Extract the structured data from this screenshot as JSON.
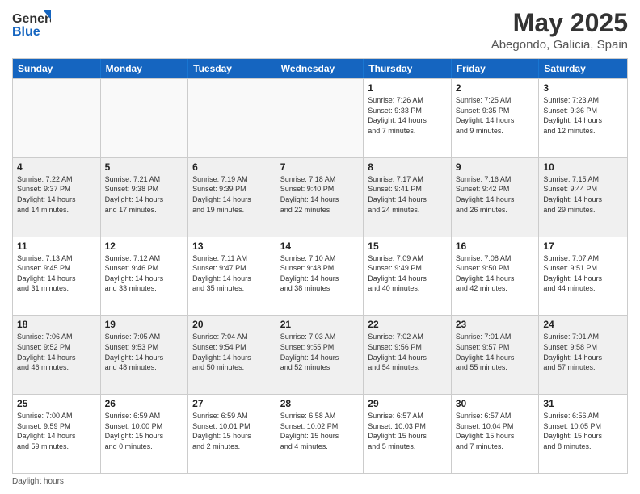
{
  "header": {
    "logo_line1": "General",
    "logo_line2": "Blue",
    "main_title": "May 2025",
    "subtitle": "Abegondo, Galicia, Spain"
  },
  "calendar": {
    "weekdays": [
      "Sunday",
      "Monday",
      "Tuesday",
      "Wednesday",
      "Thursday",
      "Friday",
      "Saturday"
    ],
    "rows": [
      [
        {
          "day": "",
          "info": "",
          "empty": true
        },
        {
          "day": "",
          "info": "",
          "empty": true
        },
        {
          "day": "",
          "info": "",
          "empty": true
        },
        {
          "day": "",
          "info": "",
          "empty": true
        },
        {
          "day": "1",
          "info": "Sunrise: 7:26 AM\nSunset: 9:33 PM\nDaylight: 14 hours\nand 7 minutes.",
          "empty": false
        },
        {
          "day": "2",
          "info": "Sunrise: 7:25 AM\nSunset: 9:35 PM\nDaylight: 14 hours\nand 9 minutes.",
          "empty": false
        },
        {
          "day": "3",
          "info": "Sunrise: 7:23 AM\nSunset: 9:36 PM\nDaylight: 14 hours\nand 12 minutes.",
          "empty": false
        }
      ],
      [
        {
          "day": "4",
          "info": "Sunrise: 7:22 AM\nSunset: 9:37 PM\nDaylight: 14 hours\nand 14 minutes.",
          "empty": false
        },
        {
          "day": "5",
          "info": "Sunrise: 7:21 AM\nSunset: 9:38 PM\nDaylight: 14 hours\nand 17 minutes.",
          "empty": false
        },
        {
          "day": "6",
          "info": "Sunrise: 7:19 AM\nSunset: 9:39 PM\nDaylight: 14 hours\nand 19 minutes.",
          "empty": false
        },
        {
          "day": "7",
          "info": "Sunrise: 7:18 AM\nSunset: 9:40 PM\nDaylight: 14 hours\nand 22 minutes.",
          "empty": false
        },
        {
          "day": "8",
          "info": "Sunrise: 7:17 AM\nSunset: 9:41 PM\nDaylight: 14 hours\nand 24 minutes.",
          "empty": false
        },
        {
          "day": "9",
          "info": "Sunrise: 7:16 AM\nSunset: 9:42 PM\nDaylight: 14 hours\nand 26 minutes.",
          "empty": false
        },
        {
          "day": "10",
          "info": "Sunrise: 7:15 AM\nSunset: 9:44 PM\nDaylight: 14 hours\nand 29 minutes.",
          "empty": false
        }
      ],
      [
        {
          "day": "11",
          "info": "Sunrise: 7:13 AM\nSunset: 9:45 PM\nDaylight: 14 hours\nand 31 minutes.",
          "empty": false
        },
        {
          "day": "12",
          "info": "Sunrise: 7:12 AM\nSunset: 9:46 PM\nDaylight: 14 hours\nand 33 minutes.",
          "empty": false
        },
        {
          "day": "13",
          "info": "Sunrise: 7:11 AM\nSunset: 9:47 PM\nDaylight: 14 hours\nand 35 minutes.",
          "empty": false
        },
        {
          "day": "14",
          "info": "Sunrise: 7:10 AM\nSunset: 9:48 PM\nDaylight: 14 hours\nand 38 minutes.",
          "empty": false
        },
        {
          "day": "15",
          "info": "Sunrise: 7:09 AM\nSunset: 9:49 PM\nDaylight: 14 hours\nand 40 minutes.",
          "empty": false
        },
        {
          "day": "16",
          "info": "Sunrise: 7:08 AM\nSunset: 9:50 PM\nDaylight: 14 hours\nand 42 minutes.",
          "empty": false
        },
        {
          "day": "17",
          "info": "Sunrise: 7:07 AM\nSunset: 9:51 PM\nDaylight: 14 hours\nand 44 minutes.",
          "empty": false
        }
      ],
      [
        {
          "day": "18",
          "info": "Sunrise: 7:06 AM\nSunset: 9:52 PM\nDaylight: 14 hours\nand 46 minutes.",
          "empty": false
        },
        {
          "day": "19",
          "info": "Sunrise: 7:05 AM\nSunset: 9:53 PM\nDaylight: 14 hours\nand 48 minutes.",
          "empty": false
        },
        {
          "day": "20",
          "info": "Sunrise: 7:04 AM\nSunset: 9:54 PM\nDaylight: 14 hours\nand 50 minutes.",
          "empty": false
        },
        {
          "day": "21",
          "info": "Sunrise: 7:03 AM\nSunset: 9:55 PM\nDaylight: 14 hours\nand 52 minutes.",
          "empty": false
        },
        {
          "day": "22",
          "info": "Sunrise: 7:02 AM\nSunset: 9:56 PM\nDaylight: 14 hours\nand 54 minutes.",
          "empty": false
        },
        {
          "day": "23",
          "info": "Sunrise: 7:01 AM\nSunset: 9:57 PM\nDaylight: 14 hours\nand 55 minutes.",
          "empty": false
        },
        {
          "day": "24",
          "info": "Sunrise: 7:01 AM\nSunset: 9:58 PM\nDaylight: 14 hours\nand 57 minutes.",
          "empty": false
        }
      ],
      [
        {
          "day": "25",
          "info": "Sunrise: 7:00 AM\nSunset: 9:59 PM\nDaylight: 14 hours\nand 59 minutes.",
          "empty": false
        },
        {
          "day": "26",
          "info": "Sunrise: 6:59 AM\nSunset: 10:00 PM\nDaylight: 15 hours\nand 0 minutes.",
          "empty": false
        },
        {
          "day": "27",
          "info": "Sunrise: 6:59 AM\nSunset: 10:01 PM\nDaylight: 15 hours\nand 2 minutes.",
          "empty": false
        },
        {
          "day": "28",
          "info": "Sunrise: 6:58 AM\nSunset: 10:02 PM\nDaylight: 15 hours\nand 4 minutes.",
          "empty": false
        },
        {
          "day": "29",
          "info": "Sunrise: 6:57 AM\nSunset: 10:03 PM\nDaylight: 15 hours\nand 5 minutes.",
          "empty": false
        },
        {
          "day": "30",
          "info": "Sunrise: 6:57 AM\nSunset: 10:04 PM\nDaylight: 15 hours\nand 7 minutes.",
          "empty": false
        },
        {
          "day": "31",
          "info": "Sunrise: 6:56 AM\nSunset: 10:05 PM\nDaylight: 15 hours\nand 8 minutes.",
          "empty": false
        }
      ]
    ]
  },
  "footer": {
    "note": "Daylight hours"
  }
}
